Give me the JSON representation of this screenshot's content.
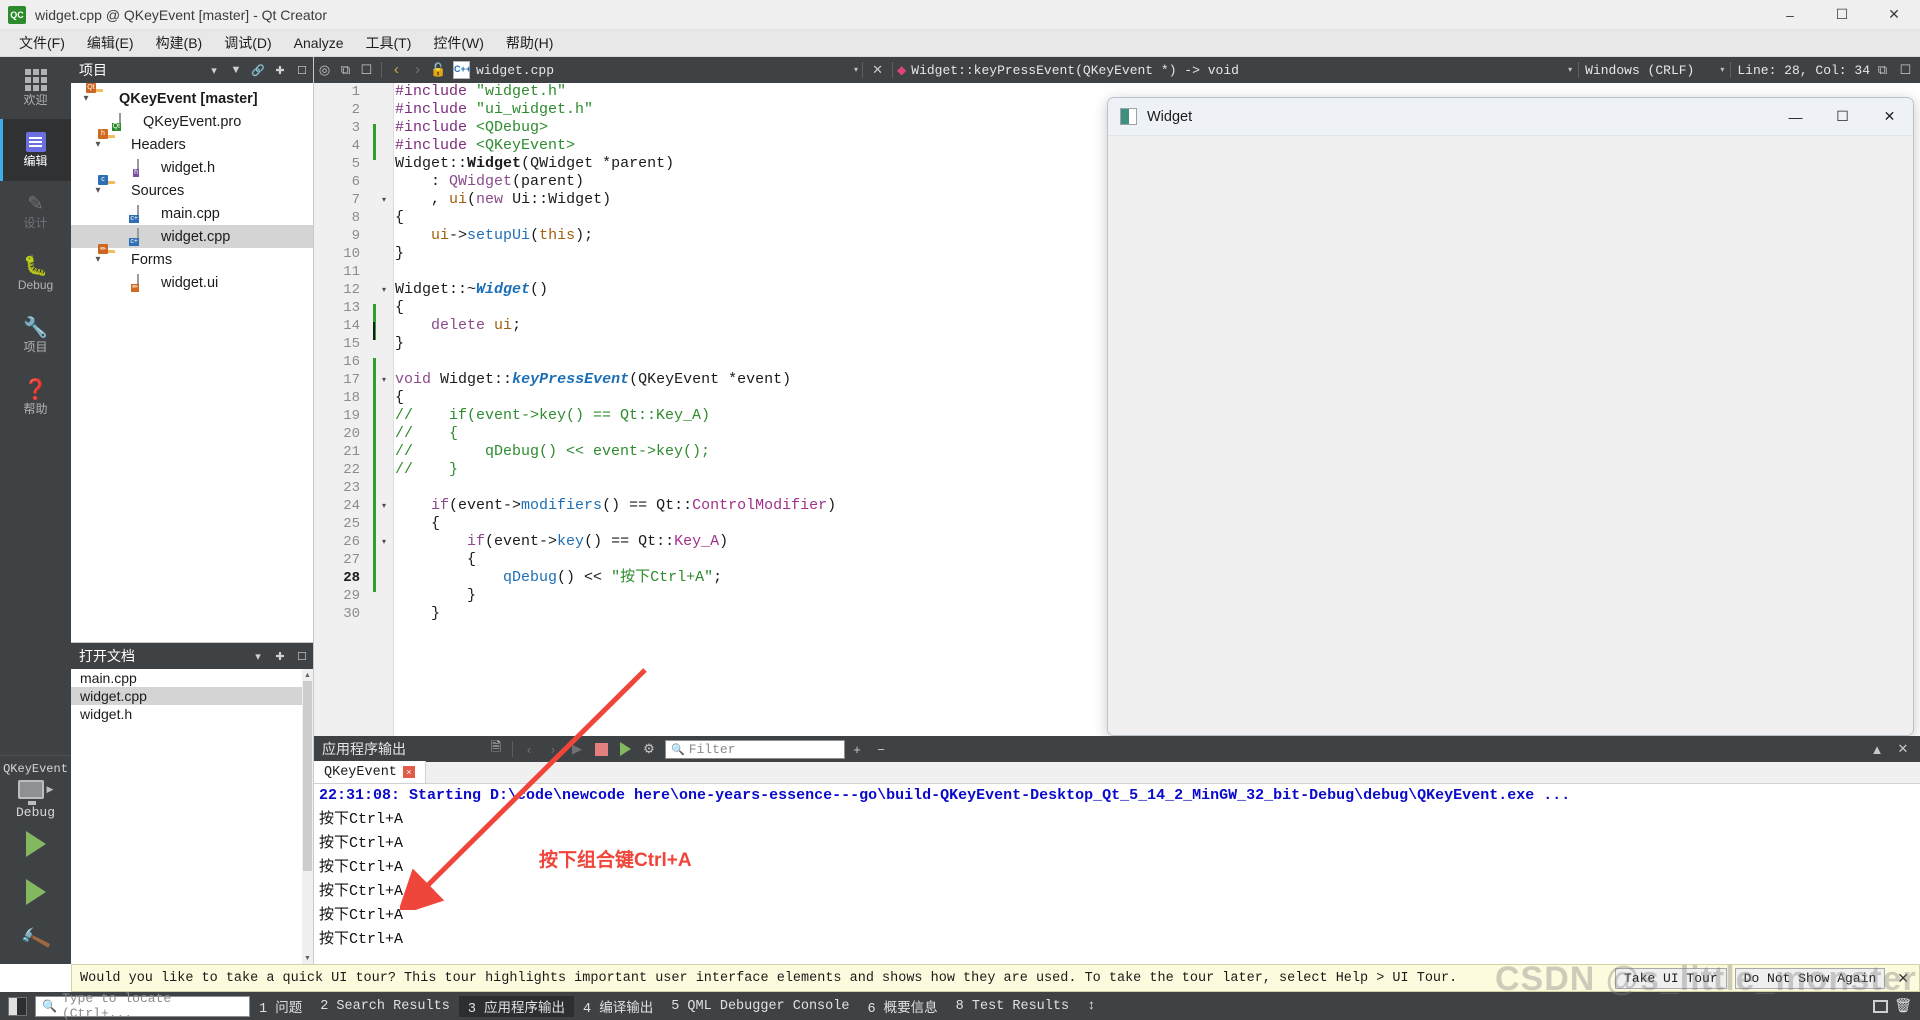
{
  "window": {
    "title": "widget.cpp @ QKeyEvent [master] - Qt Creator",
    "app_icon": "qt-creator-icon",
    "minimize": "–",
    "maximize": "☐",
    "close": "✕"
  },
  "menubar": [
    {
      "label": "文件(F)"
    },
    {
      "label": "编辑(E)"
    },
    {
      "label": "构建(B)"
    },
    {
      "label": "调试(D)"
    },
    {
      "label": "Analyze"
    },
    {
      "label": "工具(T)"
    },
    {
      "label": "控件(W)"
    },
    {
      "label": "帮助(H)"
    }
  ],
  "modebar": {
    "modes": [
      {
        "label": "欢迎",
        "icon": "grid-icon",
        "active": false,
        "dim": false
      },
      {
        "label": "编辑",
        "icon": "edit-icon",
        "active": true,
        "dim": false
      },
      {
        "label": "设计",
        "icon": "pencil-icon",
        "active": false,
        "dim": true
      },
      {
        "label": "Debug",
        "icon": "bug-icon",
        "active": false,
        "dim": false
      },
      {
        "label": "项目",
        "icon": "wrench-icon",
        "active": false,
        "dim": false
      },
      {
        "label": "帮助",
        "icon": "question-icon",
        "active": false,
        "dim": false
      }
    ],
    "kit_name": "QKeyEvent",
    "kit_mode": "Debug",
    "run_button": "run-icon",
    "debug_button": "run-debug-icon",
    "build_button": "hammer-icon"
  },
  "project_panel": {
    "header": "项目",
    "header_icons": [
      "chevron-down-icon",
      "filter-icon",
      "link-icon",
      "split-icon",
      "close-icon"
    ],
    "tree": [
      {
        "label": "QKeyEvent [master]",
        "indent": 0,
        "icon": "project-folder-icon",
        "bold": true,
        "expanded": true,
        "selected": false
      },
      {
        "label": "QKeyEvent.pro",
        "indent": 1,
        "icon": "pro-file-icon",
        "bold": false,
        "expanded": null,
        "selected": false
      },
      {
        "label": "Headers",
        "indent": 1,
        "icon": "headers-folder-icon",
        "bold": false,
        "expanded": true,
        "selected": false
      },
      {
        "label": "widget.h",
        "indent": 2,
        "icon": "header-file-icon",
        "bold": false,
        "expanded": null,
        "selected": false
      },
      {
        "label": "Sources",
        "indent": 1,
        "icon": "sources-folder-icon",
        "bold": false,
        "expanded": true,
        "selected": false
      },
      {
        "label": "main.cpp",
        "indent": 2,
        "icon": "cpp-file-icon",
        "bold": false,
        "expanded": null,
        "selected": false
      },
      {
        "label": "widget.cpp",
        "indent": 2,
        "icon": "cpp-file-icon",
        "bold": false,
        "expanded": null,
        "selected": true
      },
      {
        "label": "Forms",
        "indent": 1,
        "icon": "forms-folder-icon",
        "bold": false,
        "expanded": true,
        "selected": false
      },
      {
        "label": "widget.ui",
        "indent": 2,
        "icon": "ui-file-icon",
        "bold": false,
        "expanded": null,
        "selected": false
      }
    ]
  },
  "open_documents": {
    "header": "打开文档",
    "header_icons": [
      "chevron-down-icon",
      "split-icon",
      "close-icon"
    ],
    "items": [
      {
        "label": "main.cpp",
        "selected": false
      },
      {
        "label": "widget.cpp",
        "selected": true
      },
      {
        "label": "widget.h",
        "selected": false
      }
    ]
  },
  "editor_toolbar": {
    "icons_left": [
      "target-icon",
      "split-icon",
      "close-split-icon"
    ],
    "back": "‹",
    "forward": "›",
    "lock": "unlock-icon",
    "file_name": "widget.cpp",
    "file_dropdown": "▾",
    "file_close": "✕",
    "symbol_marker": "◆",
    "symbol": "Widget::keyPressEvent(QKeyEvent *) -> void",
    "symbol_dropdown": "▾",
    "encoding": "Windows (CRLF)",
    "encoding_dropdown": "▾",
    "cursor_position": "Line: 28, Col: 34",
    "split_icon": "split-editor-icon",
    "close_icon": "close-editor-icon"
  },
  "code": {
    "lines": [
      {
        "n": 1,
        "fold": "",
        "cur": false,
        "tokens": [
          {
            "t": "#include ",
            "c": "k"
          },
          {
            "t": "\"widget.h\"",
            "c": "str"
          }
        ]
      },
      {
        "n": 2,
        "fold": "",
        "cur": false,
        "tokens": [
          {
            "t": "#include ",
            "c": "k"
          },
          {
            "t": "\"ui_widget.h\"",
            "c": "str"
          }
        ]
      },
      {
        "n": 3,
        "fold": "",
        "cur": false,
        "tokens": [
          {
            "t": "#include ",
            "c": "k"
          },
          {
            "t": "<QDebug>",
            "c": "ang"
          }
        ]
      },
      {
        "n": 4,
        "fold": "",
        "cur": false,
        "tokens": [
          {
            "t": "#include ",
            "c": "k"
          },
          {
            "t": "<QKeyEvent>",
            "c": "ang"
          }
        ]
      },
      {
        "n": 5,
        "fold": "",
        "cur": false,
        "tokens": [
          {
            "t": "Widget",
            "c": "ty"
          },
          {
            "t": "::",
            "c": "op"
          },
          {
            "t": "Widget",
            "c": "cls"
          },
          {
            "t": "(",
            "c": "op"
          },
          {
            "t": "QWidget",
            "c": "ty"
          },
          {
            "t": " *parent)",
            "c": "op"
          }
        ]
      },
      {
        "n": 6,
        "fold": "",
        "cur": false,
        "tokens": [
          {
            "t": "    : ",
            "c": "op"
          },
          {
            "t": "QWidget",
            "c": "prm"
          },
          {
            "t": "(parent)",
            "c": "op"
          }
        ]
      },
      {
        "n": 7,
        "fold": "▾",
        "cur": false,
        "tokens": [
          {
            "t": "    , ",
            "c": "op"
          },
          {
            "t": "ui",
            "c": "var"
          },
          {
            "t": "(",
            "c": "op"
          },
          {
            "t": "new",
            "c": "prm"
          },
          {
            "t": " ",
            "c": "op"
          },
          {
            "t": "Ui",
            "c": "ty"
          },
          {
            "t": "::",
            "c": "op"
          },
          {
            "t": "Widget",
            "c": "ty"
          },
          {
            "t": ")",
            "c": "op"
          }
        ]
      },
      {
        "n": 8,
        "fold": "",
        "cur": false,
        "tokens": [
          {
            "t": "{",
            "c": "op"
          }
        ]
      },
      {
        "n": 9,
        "fold": "",
        "cur": false,
        "tokens": [
          {
            "t": "    ",
            "c": "op"
          },
          {
            "t": "ui",
            "c": "var"
          },
          {
            "t": "->",
            "c": "op"
          },
          {
            "t": "setupUi",
            "c": "mem"
          },
          {
            "t": "(",
            "c": "op"
          },
          {
            "t": "this",
            "c": "var"
          },
          {
            "t": ");",
            "c": "op"
          }
        ]
      },
      {
        "n": 10,
        "fold": "",
        "cur": false,
        "tokens": [
          {
            "t": "}",
            "c": "op"
          }
        ]
      },
      {
        "n": 11,
        "fold": "",
        "cur": false,
        "tokens": []
      },
      {
        "n": 12,
        "fold": "▾",
        "cur": false,
        "tokens": [
          {
            "t": "Widget",
            "c": "ty"
          },
          {
            "t": "::~",
            "c": "op"
          },
          {
            "t": "Widget",
            "c": "fn"
          },
          {
            "t": "()",
            "c": "op"
          }
        ]
      },
      {
        "n": 13,
        "fold": "",
        "cur": false,
        "tokens": [
          {
            "t": "{",
            "c": "op"
          }
        ]
      },
      {
        "n": 14,
        "fold": "",
        "cur": false,
        "tokens": [
          {
            "t": "    ",
            "c": "op"
          },
          {
            "t": "delete",
            "c": "prm"
          },
          {
            "t": " ",
            "c": "op"
          },
          {
            "t": "ui",
            "c": "var"
          },
          {
            "t": ";",
            "c": "op"
          }
        ]
      },
      {
        "n": 15,
        "fold": "",
        "cur": false,
        "tokens": [
          {
            "t": "}",
            "c": "op"
          }
        ]
      },
      {
        "n": 16,
        "fold": "",
        "cur": false,
        "tokens": []
      },
      {
        "n": 17,
        "fold": "▾",
        "cur": false,
        "tokens": [
          {
            "t": "void",
            "c": "prm"
          },
          {
            "t": " ",
            "c": "op"
          },
          {
            "t": "Widget",
            "c": "ty"
          },
          {
            "t": "::",
            "c": "op"
          },
          {
            "t": "keyPressEvent",
            "c": "fn"
          },
          {
            "t": "(",
            "c": "op"
          },
          {
            "t": "QKeyEvent",
            "c": "ty"
          },
          {
            "t": " *event)",
            "c": "op"
          }
        ]
      },
      {
        "n": 18,
        "fold": "",
        "cur": false,
        "tokens": [
          {
            "t": "{",
            "c": "op"
          }
        ]
      },
      {
        "n": 19,
        "fold": "",
        "cur": false,
        "tokens": [
          {
            "t": "//    if(event->key() == Qt::Key_A)",
            "c": "cm"
          }
        ]
      },
      {
        "n": 20,
        "fold": "",
        "cur": false,
        "tokens": [
          {
            "t": "//    {",
            "c": "cm"
          }
        ]
      },
      {
        "n": 21,
        "fold": "",
        "cur": false,
        "tokens": [
          {
            "t": "//        qDebug() << event->key();",
            "c": "cm"
          }
        ]
      },
      {
        "n": 22,
        "fold": "",
        "cur": false,
        "tokens": [
          {
            "t": "//    }",
            "c": "cm"
          }
        ]
      },
      {
        "n": 23,
        "fold": "",
        "cur": false,
        "tokens": []
      },
      {
        "n": 24,
        "fold": "▾",
        "cur": false,
        "tokens": [
          {
            "t": "    ",
            "c": "op"
          },
          {
            "t": "if",
            "c": "prm"
          },
          {
            "t": "(event->",
            "c": "op"
          },
          {
            "t": "modifiers",
            "c": "mem"
          },
          {
            "t": "() == ",
            "c": "op"
          },
          {
            "t": "Qt",
            "c": "ty"
          },
          {
            "t": "::",
            "c": "op"
          },
          {
            "t": "ControlModifier",
            "c": "en"
          },
          {
            "t": ")",
            "c": "op"
          }
        ]
      },
      {
        "n": 25,
        "fold": "",
        "cur": false,
        "tokens": [
          {
            "t": "    {",
            "c": "op"
          }
        ]
      },
      {
        "n": 26,
        "fold": "▾",
        "cur": false,
        "tokens": [
          {
            "t": "        ",
            "c": "op"
          },
          {
            "t": "if",
            "c": "prm"
          },
          {
            "t": "(event->",
            "c": "op"
          },
          {
            "t": "key",
            "c": "mem"
          },
          {
            "t": "() == ",
            "c": "op"
          },
          {
            "t": "Qt",
            "c": "ty"
          },
          {
            "t": "::",
            "c": "op"
          },
          {
            "t": "Key_A",
            "c": "en"
          },
          {
            "t": ")",
            "c": "op"
          }
        ]
      },
      {
        "n": 27,
        "fold": "",
        "cur": false,
        "tokens": [
          {
            "t": "        {",
            "c": "op"
          }
        ]
      },
      {
        "n": 28,
        "fold": "",
        "cur": true,
        "tokens": [
          {
            "t": "            ",
            "c": "op"
          },
          {
            "t": "qDebug",
            "c": "mem"
          },
          {
            "t": "() << ",
            "c": "op"
          },
          {
            "t": "\"按下Ctrl+A\"",
            "c": "str"
          },
          {
            "t": ";",
            "c": "op"
          }
        ]
      },
      {
        "n": 29,
        "fold": "",
        "cur": false,
        "tokens": [
          {
            "t": "        }",
            "c": "op"
          }
        ]
      },
      {
        "n": 30,
        "fold": "",
        "cur": false,
        "tokens": [
          {
            "t": "    }",
            "c": "op"
          }
        ]
      }
    ]
  },
  "widget_window": {
    "title": "Widget",
    "icon": "widget-app-icon",
    "minimize": "—",
    "maximize": "☐",
    "close": "✕"
  },
  "output_pane": {
    "title": "应用程序输出",
    "icons": [
      "select-all-icon",
      "prev-icon",
      "next-icon",
      "next-item-icon",
      "stop-icon",
      "rerun-icon",
      "settings-icon"
    ],
    "filter_placeholder": "Filter",
    "add_label": "+",
    "remove_label": "−",
    "maximize_icon": "chevron-up-icon",
    "close_icon": "close-icon",
    "tabs": [
      {
        "label": "QKeyEvent",
        "close": "×",
        "active": true
      }
    ],
    "lines": [
      {
        "text": "22:31:08: Starting D:\\code\\newcode here\\one-years-essence---go\\build-QKeyEvent-Desktop_Qt_5_14_2_MinGW_32_bit-Debug\\debug\\QKeyEvent.exe ...",
        "type": "start"
      },
      {
        "text": "按下Ctrl+A",
        "type": "msg"
      },
      {
        "text": "按下Ctrl+A",
        "type": "msg"
      },
      {
        "text": "按下Ctrl+A",
        "type": "msg"
      },
      {
        "text": "按下Ctrl+A",
        "type": "msg"
      },
      {
        "text": "按下Ctrl+A",
        "type": "msg"
      },
      {
        "text": "按下Ctrl+A",
        "type": "msg"
      }
    ]
  },
  "annotation": {
    "text": "按下组合键Ctrl+A",
    "color": "#f0453a",
    "arrow": "red-arrow"
  },
  "notification": {
    "text": "Would you like to take a quick UI tour? This tour highlights important user interface elements and shows how they are used. To take the tour later, select Help > UI Tour.",
    "buttons": [
      {
        "label": "Take UI Tour"
      },
      {
        "label": "Do Not Show Again"
      }
    ],
    "close": "✕"
  },
  "statusbar": {
    "sidebar_toggle": "sidebar-toggle-icon",
    "locator_placeholder": "Type to locate (Ctrl+...",
    "locator_icon": "search-icon",
    "items": [
      {
        "label": "1 问题",
        "active": false
      },
      {
        "label": "2 Search Results",
        "active": false
      },
      {
        "label": "3 应用程序输出",
        "active": true
      },
      {
        "label": "4 编译输出",
        "active": false
      },
      {
        "label": "5 QML Debugger Console",
        "active": false
      },
      {
        "label": "6 概要信息",
        "active": false
      },
      {
        "label": "8 Test Results",
        "active": false
      }
    ],
    "updown": "↕",
    "right_icons": [
      "minimize-pane-icon",
      "close-pane-icon"
    ]
  },
  "watermark": {
    "text": "CSDN @s_little_monster"
  },
  "colors": {
    "dark_chrome": "#3f4244",
    "accent_blue": "#3daee9",
    "output_blue": "#0a0acb",
    "annotation_red": "#f0453a",
    "selection_gray": "#d4d4d4"
  }
}
